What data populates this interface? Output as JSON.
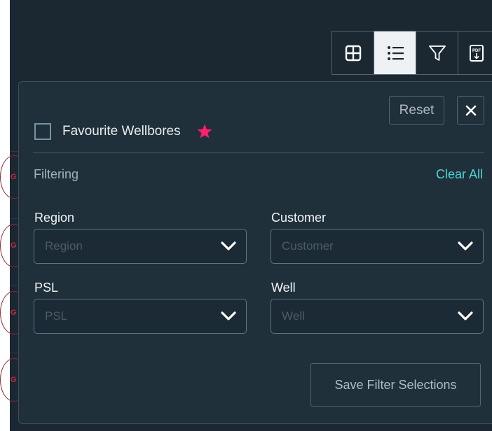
{
  "background": {
    "badge_text": "G"
  },
  "toolbar": {
    "buttons": [
      {
        "icon": "grid-view-icon",
        "active": false
      },
      {
        "icon": "list-view-icon",
        "active": true
      },
      {
        "icon": "filter-icon",
        "active": false
      },
      {
        "icon": "pdf-download-icon",
        "active": false,
        "text": "PDF"
      }
    ]
  },
  "panel": {
    "reset_label": "Reset",
    "favourite_label": "Favourite Wellbores",
    "favourite_checked": false,
    "section_label": "Filtering",
    "clear_all_label": "Clear All",
    "fields": {
      "region": {
        "label": "Region",
        "placeholder": "Region"
      },
      "customer": {
        "label": "Customer",
        "placeholder": "Customer"
      },
      "psl": {
        "label": "PSL",
        "placeholder": "PSL"
      },
      "well": {
        "label": "Well",
        "placeholder": "Well"
      }
    },
    "save_label": "Save Filter Selections"
  },
  "colors": {
    "background": "#1c2831",
    "panel": "#1f303b",
    "accent": "#4fd6d2",
    "star": "#ff1f6e",
    "badge": "#c0293f"
  }
}
